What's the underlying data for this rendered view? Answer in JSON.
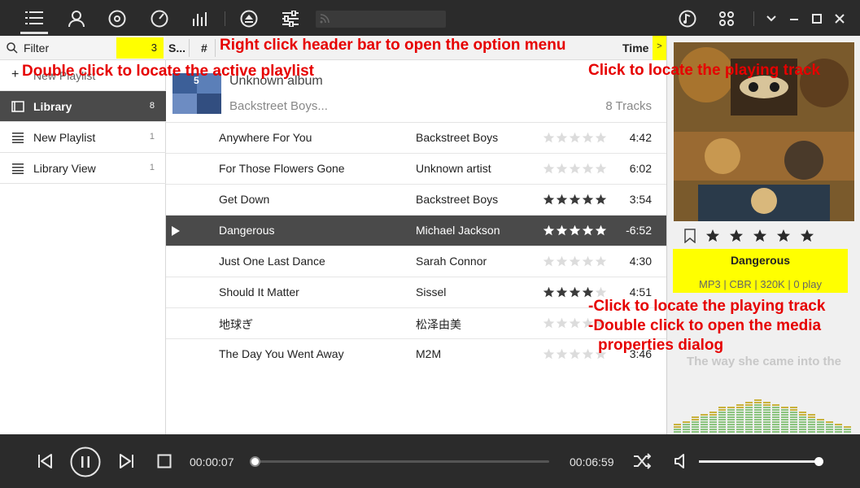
{
  "toolbar": {
    "icons": [
      "menu-icon",
      "user-icon",
      "disc-icon",
      "gauge-icon",
      "bars-chart-icon",
      "eject-icon",
      "sliders-icon",
      "rss-icon",
      "music-note-icon",
      "grid-icon",
      "chevron-down-icon",
      "minimize-icon",
      "maximize-icon",
      "close-icon"
    ]
  },
  "filter": {
    "label": "Filter",
    "count": "3"
  },
  "playlists": [
    {
      "label": "New Playlist",
      "count": "",
      "icon": "plus-icon"
    },
    {
      "label": "Library",
      "count": "8",
      "icon": "library-icon"
    },
    {
      "label": "New Playlist",
      "count": "1",
      "icon": "list-icon"
    },
    {
      "label": "Library View",
      "count": "1",
      "icon": "list-icon"
    }
  ],
  "header": {
    "col_s": "S...",
    "col_num": "#",
    "col_time": "Time",
    "more": ">"
  },
  "album": {
    "title": "Unknown album",
    "artist": "Backstreet Boys...",
    "tracks": "8 Tracks",
    "cover_badge": "5"
  },
  "tracks": [
    {
      "title": "Anywhere For You",
      "artist": "Backstreet Boys",
      "rating": 0,
      "time": "4:42"
    },
    {
      "title": "For Those Flowers Gone",
      "artist": "Unknown artist",
      "rating": 0,
      "time": "6:02"
    },
    {
      "title": "Get Down",
      "artist": "Backstreet Boys",
      "rating": 5,
      "time": "3:54"
    },
    {
      "title": "Dangerous",
      "artist": "Michael Jackson",
      "rating": 5,
      "time": "-6:52",
      "playing": true
    },
    {
      "title": "Just One Last Dance",
      "artist": "Sarah Connor",
      "rating": 0,
      "time": "4:30"
    },
    {
      "title": "Should It Matter",
      "artist": "Sissel",
      "rating": 4,
      "time": "4:51"
    },
    {
      "title": "地球ぎ",
      "artist": "松泽由美",
      "rating": 0,
      "time": ""
    },
    {
      "title": "The Day You Went Away",
      "artist": "M2M",
      "rating": 0,
      "time": "3:46"
    }
  ],
  "now_playing": {
    "title": "Dangerous",
    "meta": "MP3 | CBR | 320K | 0 play",
    "rating": 5,
    "lyric": "The way she came into the"
  },
  "annotations": {
    "header": "Right click header bar to open the option menu",
    "playlist": "Double click to locate the active playlist",
    "playing": "Click to locate the playing track",
    "info_1": "-Click to locate the playing track",
    "info_2": "-Double click to open the media",
    "info_3": "properties dialog"
  },
  "player": {
    "elapsed": "00:00:07",
    "total": "00:06:59",
    "progress": 0.017,
    "volume": 0.98
  },
  "colors": {
    "highlight": "#ffff00",
    "annotation": "#e60000",
    "dark": "#2b2b2b",
    "selected_row": "#4a4a4a"
  }
}
